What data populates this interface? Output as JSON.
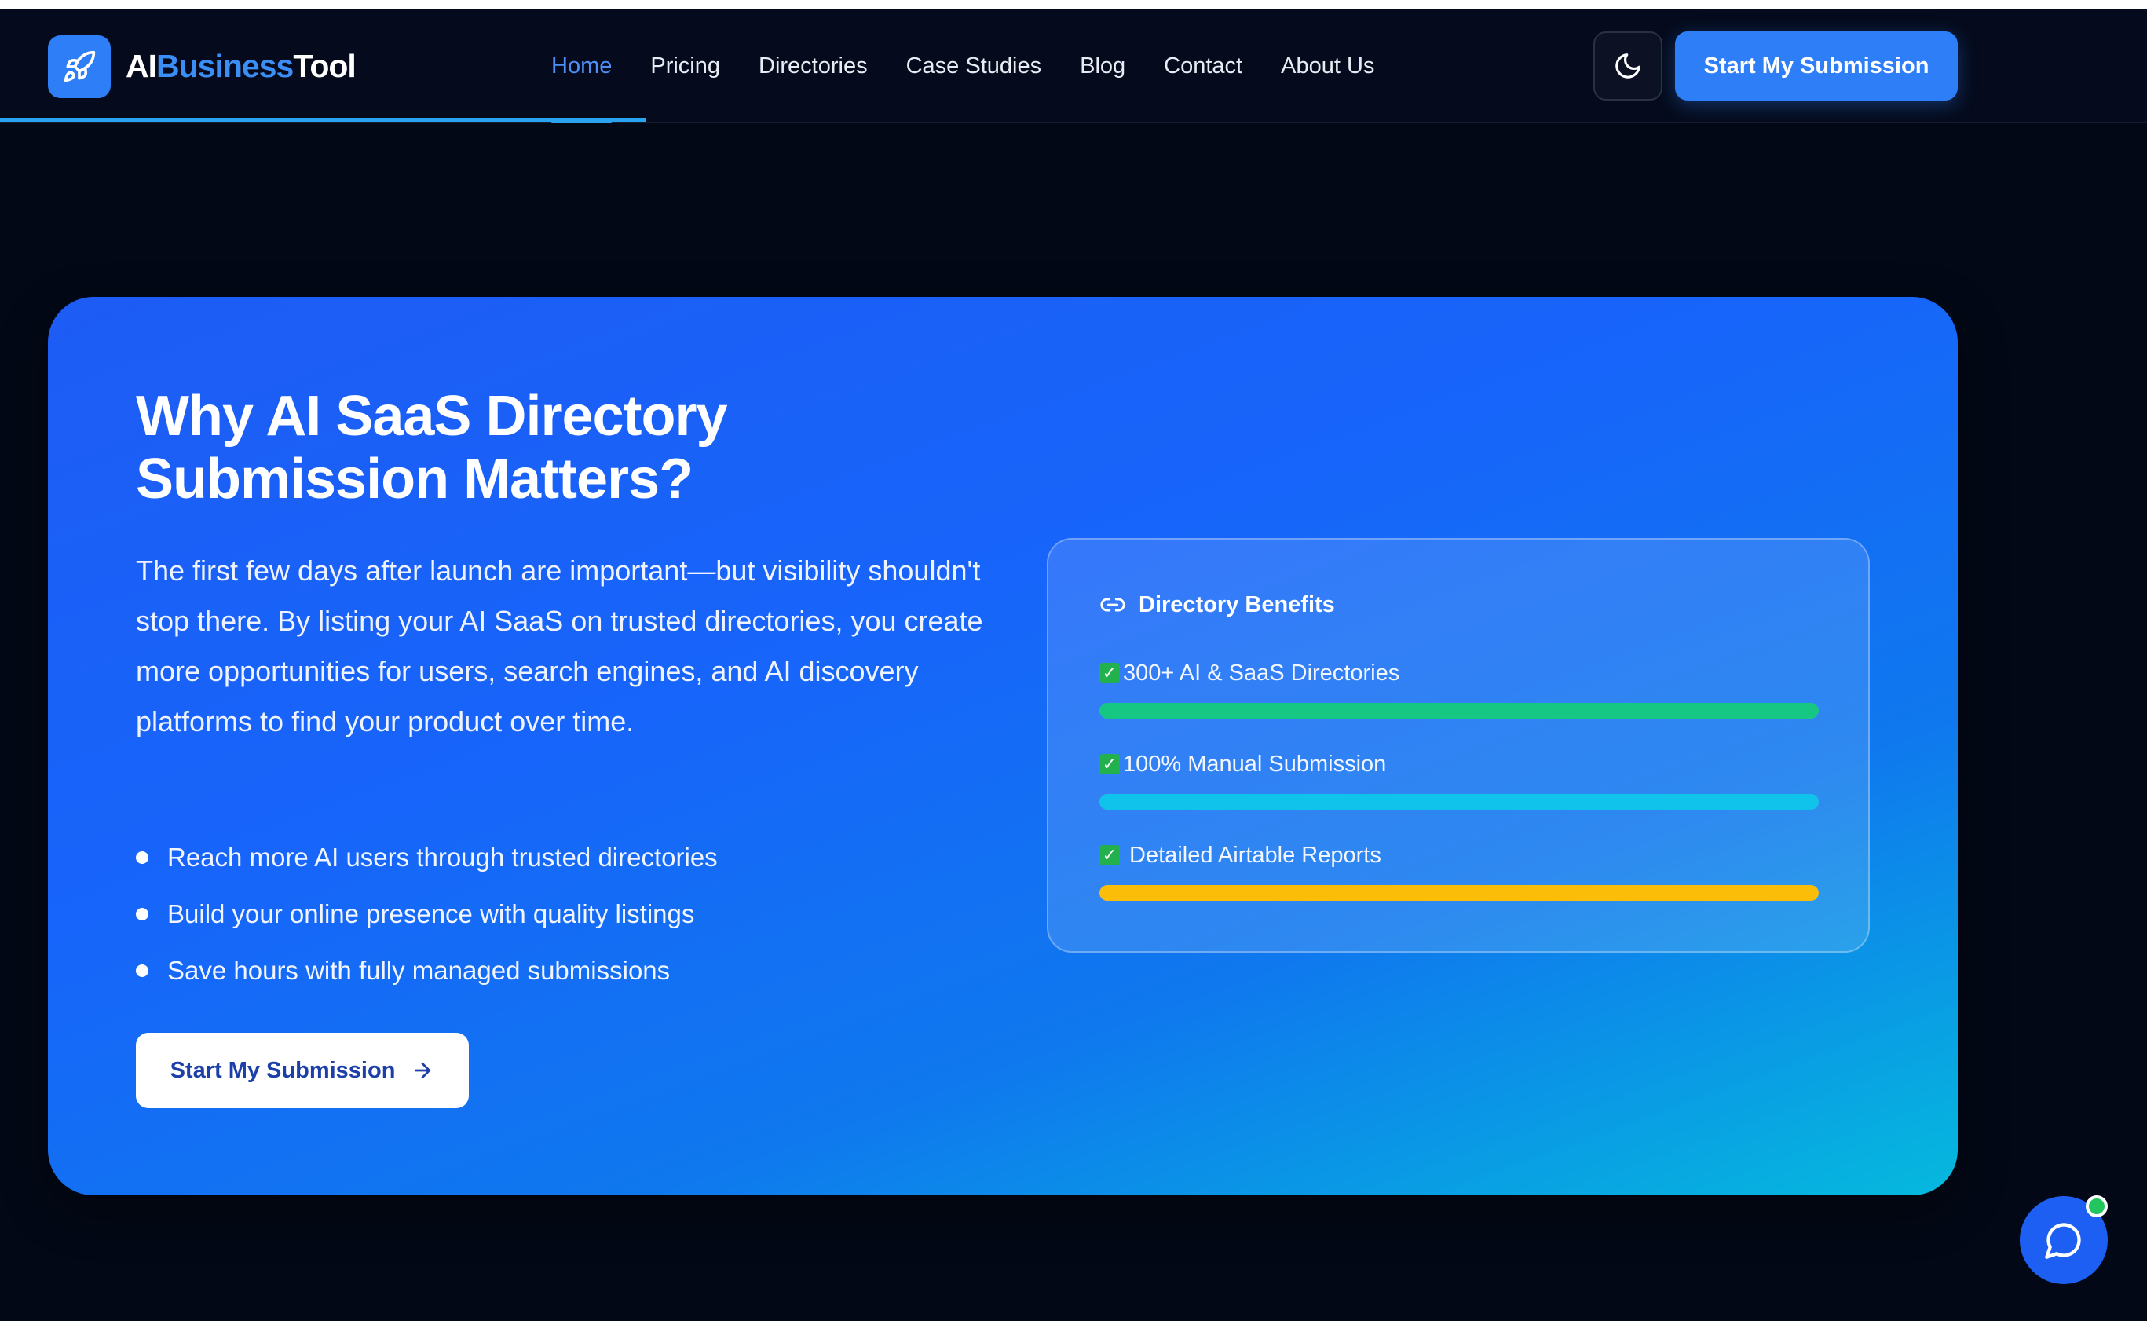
{
  "brand": {
    "part1": "AI",
    "part2": "Business",
    "part3": "Tool",
    "logo_icon": "rocket-icon",
    "accent": "#2d7ef7"
  },
  "nav": {
    "links": [
      "Home",
      "Pricing",
      "Directories",
      "Case Studies",
      "Blog",
      "Contact",
      "About Us"
    ],
    "active": "Home",
    "theme_icon": "moon-icon",
    "cta_label": "Start My Submission"
  },
  "hero": {
    "title_line1": "Why AI SaaS Directory",
    "title_line2": "Submission Matters?",
    "description": "The first few days after launch are important—but visibility shouldn't stop there. By listing your AI SaaS on trusted directories, you create more opportunities for users, search engines, and AI discovery platforms to find your product over time.",
    "bullets": [
      "Reach more AI users through trusted directories",
      "Build your online presence with quality listings",
      "Save hours with fully managed submissions"
    ],
    "cta_label": "Start My Submission",
    "cta_icon": "arrow-right-icon"
  },
  "benefits_card": {
    "title": "Directory Benefits",
    "title_icon": "link-icon",
    "items": [
      {
        "label": "300+ AI & SaaS Directories",
        "percent": 100,
        "color": "#16c784"
      },
      {
        "label": "100% Manual Submission",
        "percent": 100,
        "color": "#0fc3ea"
      },
      {
        "label": " Detailed Airtable Reports",
        "percent": 100,
        "color": "#fbbd08"
      }
    ]
  },
  "chat": {
    "icon": "chat-bubble-icon",
    "status_color": "#22c55e"
  }
}
